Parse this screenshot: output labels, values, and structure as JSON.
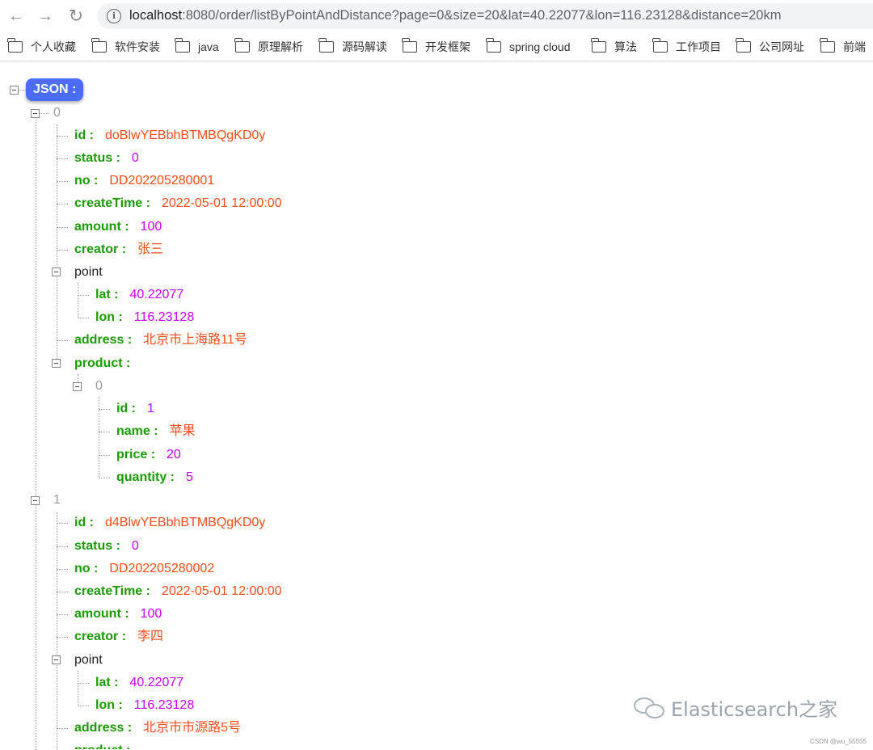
{
  "browser": {
    "url_host": "localhost",
    "url_rest": ":8080/order/listByPointAndDistance?page=0&size=20&lat=40.22077&lon=116.23128&distance=20km",
    "bookmarks": [
      "个人收藏",
      "软件安装",
      "java",
      "原理解析",
      "源码解读",
      "开发框架",
      "spring cloud",
      "算法",
      "工作项目",
      "公司网址",
      "前端"
    ]
  },
  "json": {
    "root_label": "JSON :",
    "orders": [
      {
        "index": "0",
        "id": "doBlwYEBbhBTMBQgKD0y",
        "status": "0",
        "no": "DD202205280001",
        "createTime": "2022-05-01 12:00:00",
        "amount": "100",
        "creator": "张三",
        "lat": "40.22077",
        "lon": "116.23128",
        "address": "北京市上海路11号",
        "product": {
          "index": "0",
          "id": "1",
          "name": "苹果",
          "price": "20",
          "quantity": "5"
        }
      },
      {
        "index": "1",
        "id": "d4BlwYEBbhBTMBQgKD0y",
        "status": "0",
        "no": "DD202205280002",
        "createTime": "2022-05-01 12:00:00",
        "amount": "100",
        "creator": "李四",
        "lat": "40.22077",
        "lon": "116.23128",
        "address": "北京市市源路5号",
        "product_label": "product :"
      }
    ],
    "keys": {
      "id": "id :",
      "status": "status :",
      "no": "no :",
      "createTime": "createTime :",
      "amount": "amount :",
      "creator": "creator :",
      "point": "point",
      "lat": "lat :",
      "lon": "lon :",
      "address": "address :",
      "product": "product :",
      "name": "name :",
      "price": "price :",
      "quantity": "quantity :"
    }
  },
  "watermark": {
    "text": "Elasticsearch之家",
    "credit": "CSDN @wu_55555"
  }
}
